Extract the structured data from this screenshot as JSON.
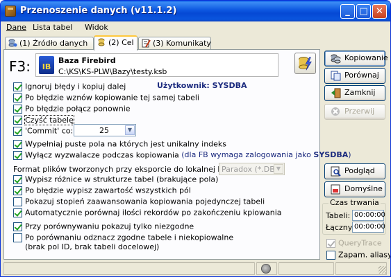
{
  "window": {
    "title": "Przenoszenie danych (v11.1.2)"
  },
  "menu": [
    {
      "label": "Dane"
    },
    {
      "label": "Lista tabel"
    },
    {
      "label": "Widok"
    }
  ],
  "tabs": [
    {
      "label": "(1) Źródło danych",
      "icon": "database-icon"
    },
    {
      "label": "(2) Cel",
      "icon": "target-db-icon",
      "active": true
    },
    {
      "label": "(3) Komunikaty",
      "icon": "notepad-icon"
    }
  ],
  "target": {
    "key": "F3:",
    "db_type": "Baza Firebird",
    "db_icon_text": "IB",
    "path": "C:\\KS\\KS-PLW\\Bazy\\testy.ksb",
    "user_label": "Użytkownik: SYSDBA"
  },
  "options": [
    {
      "label": "Ignoruj błędy i kopiuj dalej",
      "checked": true
    },
    {
      "label": "Po błędzie wznów kopiowanie tej samej tabeli",
      "checked": true
    },
    {
      "label": "Po błędzie połącz ponownie",
      "checked": true
    },
    {
      "label": "Czyść tabelę",
      "checked": true
    },
    {
      "label": "'Commit' co:",
      "checked": true
    },
    {
      "label": "Wypełniaj puste pola na których jest unikalny indeks",
      "checked": true
    },
    {
      "label": "Wyłącz wyzwalacze podczas kopiowania",
      "checked": true,
      "note": "(dla FB wymaga zalogowania jako ",
      "note_bold": "SYSDBA",
      "note_end": ")"
    }
  ],
  "commit_value": "25",
  "format_label": "Format plików tworzonych przy eksporcie do lokalnej kartoteki:",
  "format_value": "Paradox (*.DB)",
  "options2": [
    {
      "label": "Wypisz różnice w strukturze tabel (brakujące pola)",
      "checked": true
    },
    {
      "label": "Po błędzie wypisz zawartość wszystkich pól",
      "checked": true
    },
    {
      "label": "Pokazuj stopień zaawansowania kopiowania pojedynczej tabeli",
      "checked": false
    },
    {
      "label": "Automatycznie porównaj ilości rekordów po zakończeniu kpiowania",
      "checked": true
    },
    {
      "label": "Przy porównywaniu pokazuj tylko niezgodne",
      "checked": true
    },
    {
      "label": "Po porównaniu odznacz zgodne tabele i niekopiowalne",
      "label2": "(brak pol ID, brak tabeli docelowej)",
      "checked": false
    }
  ],
  "side_buttons": [
    {
      "label": "Kopiowanie",
      "icon": "copy-icon"
    },
    {
      "label": "Porównaj",
      "icon": "compare-icon"
    },
    {
      "label": "Zamknij",
      "icon": "exit-icon"
    },
    {
      "label": "Przerwij",
      "icon": "stop-icon",
      "disabled": true
    },
    {
      "label": "Podgląd",
      "icon": "preview-icon"
    },
    {
      "label": "Domyślne",
      "icon": "defaults-icon"
    }
  ],
  "duration": {
    "title": "Czas trwania",
    "table_label": "Tabeli:",
    "table_value": "00:00:00",
    "total_label": "Łączny:",
    "total_value": "00:00:00"
  },
  "query_trace": {
    "label": "QueryTrace",
    "checked": true,
    "disabled": true
  },
  "save_aliases": {
    "label": "Zapam. aliasy",
    "checked": false
  }
}
